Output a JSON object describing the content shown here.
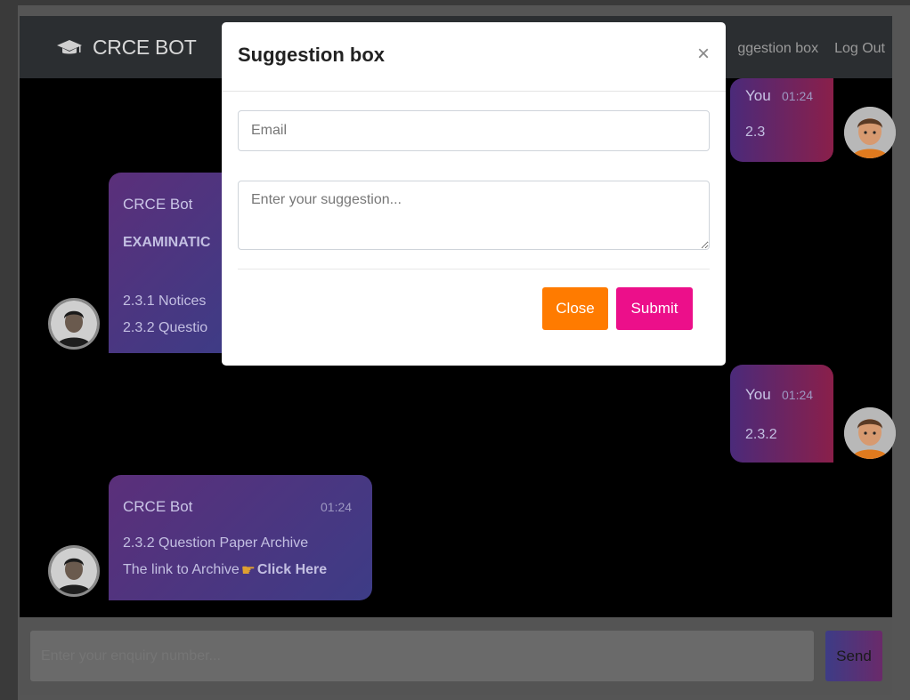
{
  "navbar": {
    "brand": "CRCE BOT",
    "links": [
      "ggestion box",
      "Log Out"
    ]
  },
  "messages": [
    {
      "sender": "You",
      "time": "01:24",
      "lines": [
        "2.3"
      ]
    },
    {
      "sender": "CRCE Bot",
      "time": "",
      "lines": [
        "EXAMINATIC",
        "",
        "2.3.1 Notices",
        "2.3.2 Questio"
      ]
    },
    {
      "sender": "You",
      "time": "01:24",
      "lines": [
        "2.3.2"
      ]
    },
    {
      "sender": "CRCE Bot",
      "time": "01:24",
      "lines": [
        "2.3.2 Question Paper Archive",
        "The link to Archive",
        "Click Here"
      ]
    }
  ],
  "input": {
    "placeholder": "Enter your enquiry number...",
    "send_label": "Send"
  },
  "modal": {
    "title": "Suggestion box",
    "close_symbol": "×",
    "email_placeholder": "Email",
    "suggestion_placeholder": "Enter your suggestion...",
    "close_label": "Close",
    "submit_label": "Submit"
  },
  "colors": {
    "navbar": "#2b2e31",
    "close_button": "#ff7b00",
    "submit_button": "#ec0f8a",
    "bot_bubble": "#4a357f",
    "user_bubble": "#7a2350"
  }
}
